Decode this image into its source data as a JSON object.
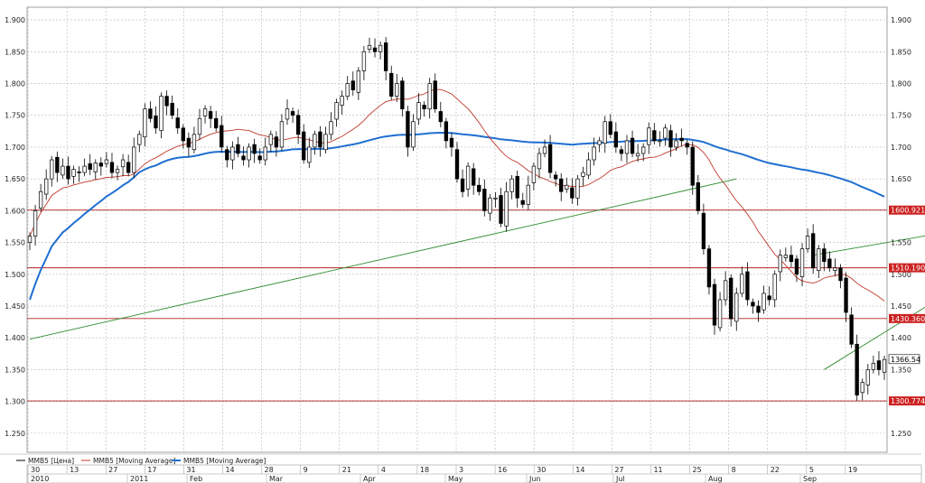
{
  "chart_data": {
    "type": "candlestick",
    "y_axis": {
      "range": [
        1220,
        1920
      ],
      "ticks": [
        "1.900",
        "1.850",
        "1.800",
        "1.750",
        "1.700",
        "1.650",
        "1.600",
        "1.550",
        "1.500",
        "1.450",
        "1.400",
        "1.350",
        "1.300",
        "1.250"
      ],
      "tick_values": [
        1900,
        1850,
        1800,
        1750,
        1700,
        1650,
        1600,
        1550,
        1500,
        1450,
        1400,
        1350,
        1300,
        1250
      ]
    },
    "x_axis": {
      "day_labels": [
        "30",
        "13",
        "27",
        "17",
        "31",
        "14",
        "28",
        "9",
        "21",
        "4",
        "18",
        "3",
        "16",
        "30",
        "14",
        "27",
        "11",
        "25",
        "8",
        "22",
        "5",
        "19"
      ],
      "month_labels": [
        "2010",
        "2011",
        "Feb",
        "Mar",
        "Apr",
        "May",
        "Jun",
        "Jul",
        "Aug",
        "Sep"
      ]
    },
    "grid": true,
    "legend": [
      {
        "label": "MMB5 [Цена]",
        "color": "#000000"
      },
      {
        "label": "MMB5 [Moving Average]",
        "color": "#c0392b"
      },
      {
        "label": "MMB5 [Moving Average]",
        "color": "#1f6fd1"
      }
    ],
    "horizontal_levels": [
      {
        "value": 1600.92129,
        "label": "1600.92129"
      },
      {
        "value": 1510.19043,
        "label": "1510.19043"
      },
      {
        "value": 1430.36086,
        "label": "1430.36086"
      },
      {
        "value": 1300.77485,
        "label": "1300.77485"
      }
    ],
    "last_price": {
      "value": 1366.54,
      "label": "1366.54"
    },
    "trendlines": [
      {
        "from": [
          0,
          1398
        ],
        "to": [
          129,
          1650
        ]
      },
      {
        "from": [
          143,
          1530
        ],
        "to": [
          176,
          1579
        ]
      },
      {
        "from": [
          145,
          1350
        ],
        "to": [
          176,
          1515
        ]
      }
    ],
    "colors": {
      "long_ma": "#1f6fd1",
      "short_ma": "#c0392b",
      "trendline": "#2e8b2e",
      "level": "#b22222",
      "tag_bg": "#cc2222"
    },
    "closes": [
      1560,
      1600,
      1630,
      1650,
      1680,
      1660,
      1670,
      1650,
      1665,
      1660,
      1670,
      1665,
      1675,
      1670,
      1680,
      1660,
      1665,
      1680,
      1660,
      1700,
      1720,
      1760,
      1745,
      1730,
      1780,
      1765,
      1750,
      1730,
      1710,
      1700,
      1720,
      1745,
      1760,
      1745,
      1730,
      1700,
      1680,
      1700,
      1690,
      1680,
      1700,
      1690,
      1680,
      1700,
      1720,
      1700,
      1740,
      1760,
      1750,
      1720,
      1680,
      1700,
      1720,
      1700,
      1720,
      1740,
      1770,
      1780,
      1800,
      1790,
      1820,
      1850,
      1860,
      1850,
      1860,
      1820,
      1780,
      1800,
      1760,
      1700,
      1740,
      1770,
      1760,
      1800,
      1760,
      1740,
      1710,
      1700,
      1650,
      1630,
      1670,
      1640,
      1630,
      1600,
      1620,
      1620,
      1580,
      1630,
      1650,
      1620,
      1610,
      1640,
      1670,
      1690,
      1700,
      1660,
      1650,
      1630,
      1640,
      1620,
      1650,
      1660,
      1680,
      1700,
      1710,
      1740,
      1720,
      1700,
      1690,
      1710,
      1690,
      1690,
      1700,
      1730,
      1710,
      1710,
      1730,
      1700,
      1710,
      1710,
      1700,
      1640,
      1600,
      1540,
      1480,
      1420,
      1460,
      1490,
      1430,
      1470,
      1500,
      1460,
      1450,
      1440,
      1470,
      1460,
      1500,
      1530,
      1530,
      1520,
      1500,
      1540,
      1560,
      1510,
      1540,
      1520,
      1510,
      1510,
      1490,
      1440,
      1390,
      1310,
      1330,
      1350,
      1360,
      1350,
      1366
    ]
  }
}
